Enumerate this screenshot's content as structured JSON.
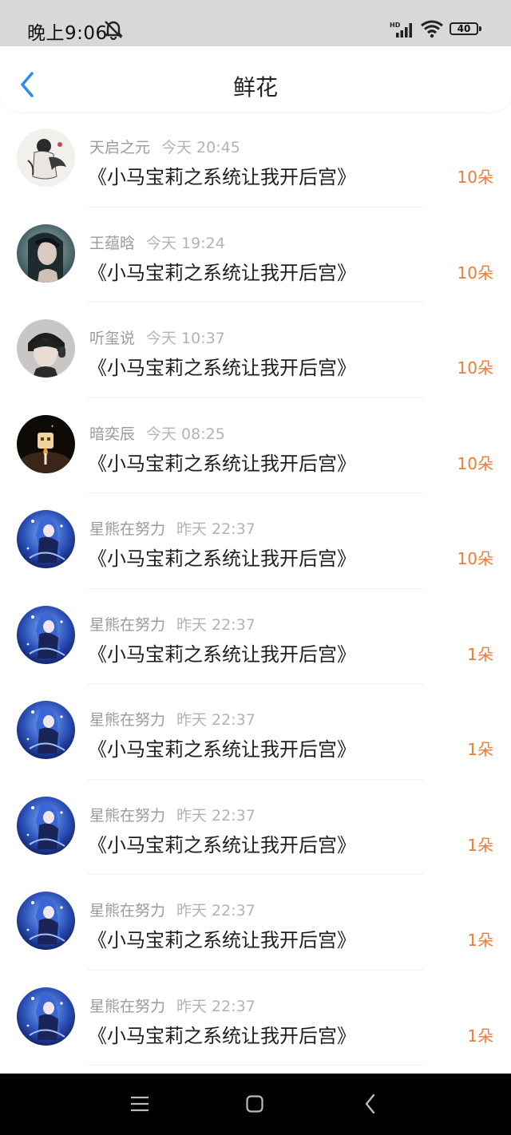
{
  "status_bar": {
    "time": "晚上9:06",
    "battery": "40"
  },
  "header": {
    "title": "鲜花"
  },
  "colors": {
    "accent_blue": "#2e8bf0",
    "count_orange": "#ef7b34"
  },
  "items": [
    {
      "user": "天启之元",
      "time": "今天 20:45",
      "book": "《小马宝莉之系统让我开后宫》",
      "count": "10朵",
      "avatar": "avatar-ink"
    },
    {
      "user": "王蕴晗",
      "time": "今天 19:24",
      "book": "《小马宝莉之系统让我开后宫》",
      "count": "10朵",
      "avatar": "avatar-portrait-teal"
    },
    {
      "user": "听玺说",
      "time": "今天 10:37",
      "book": "《小马宝莉之系统让我开后宫》",
      "count": "10朵",
      "avatar": "avatar-headphones"
    },
    {
      "user": "暗奕辰",
      "time": "今天 08:25",
      "book": "《小马宝莉之系统让我开后宫》",
      "count": "10朵",
      "avatar": "avatar-candle"
    },
    {
      "user": "星熊在努力",
      "time": "昨天 22:37",
      "book": "《小马宝莉之系统让我开后宫》",
      "count": "10朵",
      "avatar": "avatar-blue-anime"
    },
    {
      "user": "星熊在努力",
      "time": "昨天 22:37",
      "book": "《小马宝莉之系统让我开后宫》",
      "count": "1朵",
      "avatar": "avatar-blue-anime"
    },
    {
      "user": "星熊在努力",
      "time": "昨天 22:37",
      "book": "《小马宝莉之系统让我开后宫》",
      "count": "1朵",
      "avatar": "avatar-blue-anime"
    },
    {
      "user": "星熊在努力",
      "time": "昨天 22:37",
      "book": "《小马宝莉之系统让我开后宫》",
      "count": "1朵",
      "avatar": "avatar-blue-anime"
    },
    {
      "user": "星熊在努力",
      "time": "昨天 22:37",
      "book": "《小马宝莉之系统让我开后宫》",
      "count": "1朵",
      "avatar": "avatar-blue-anime"
    },
    {
      "user": "星熊在努力",
      "time": "昨天 22:37",
      "book": "《小马宝莉之系统让我开后宫》",
      "count": "1朵",
      "avatar": "avatar-blue-anime"
    }
  ]
}
